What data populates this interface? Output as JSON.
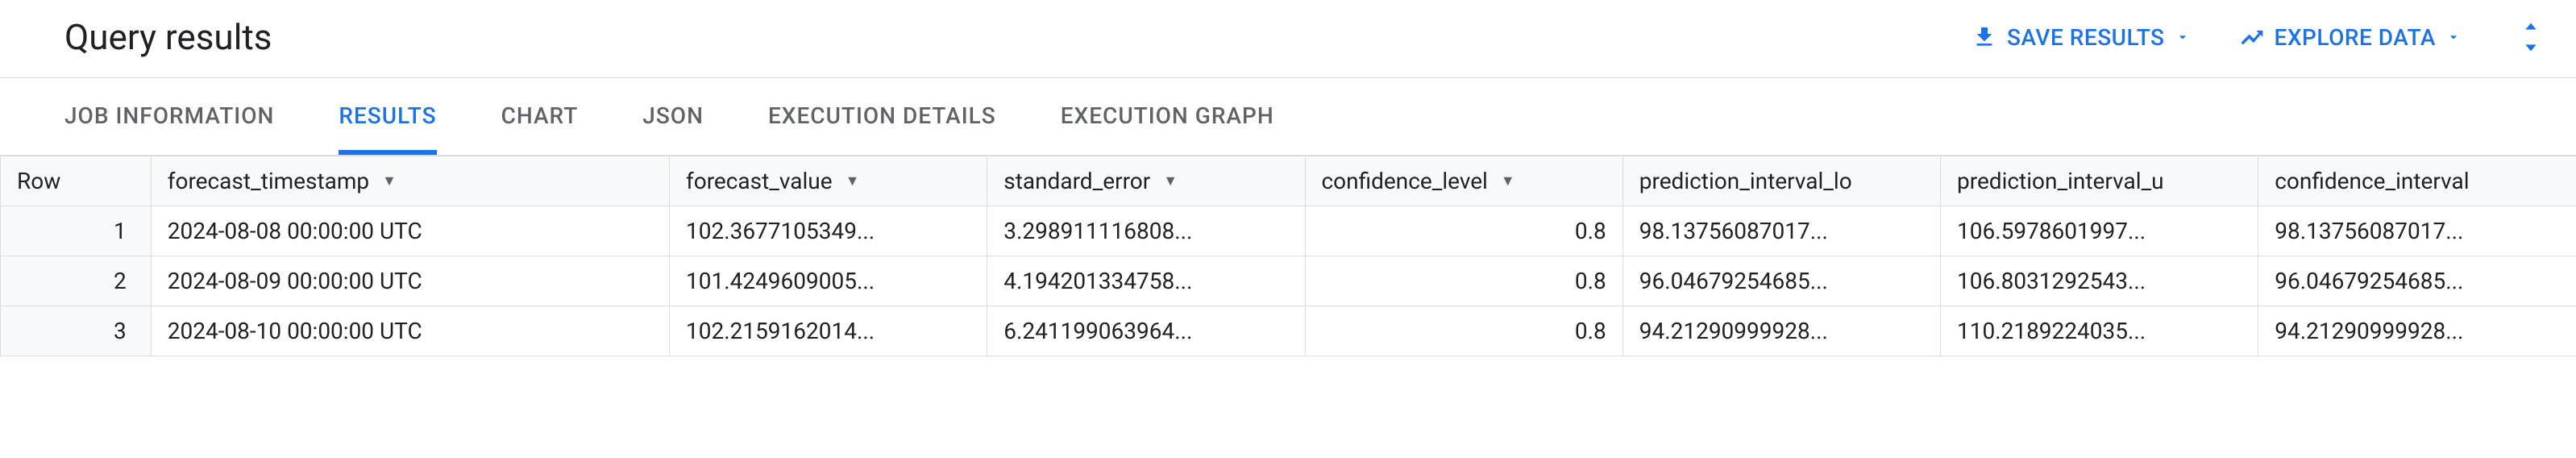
{
  "header": {
    "title": "Query results",
    "save_label": "SAVE RESULTS",
    "explore_label": "EXPLORE DATA"
  },
  "tabs": {
    "job_info": "JOB INFORMATION",
    "results": "RESULTS",
    "chart": "CHART",
    "json": "JSON",
    "execution_details": "EXECUTION DETAILS",
    "execution_graph": "EXECUTION GRAPH"
  },
  "columns": {
    "row": "Row",
    "forecast_timestamp": "forecast_timestamp",
    "forecast_value": "forecast_value",
    "standard_error": "standard_error",
    "confidence_level": "confidence_level",
    "prediction_interval_lower": "prediction_interval_lo",
    "prediction_interval_upper": "prediction_interval_u",
    "confidence_interval": "confidence_interval"
  },
  "rows": [
    {
      "row": "1",
      "forecast_timestamp": "2024-08-08 00:00:00 UTC",
      "forecast_value": "102.3677105349...",
      "standard_error": "3.298911116808...",
      "confidence_level": "0.8",
      "prediction_interval_lower": "98.13756087017...",
      "prediction_interval_upper": "106.5978601997...",
      "confidence_interval": "98.13756087017..."
    },
    {
      "row": "2",
      "forecast_timestamp": "2024-08-09 00:00:00 UTC",
      "forecast_value": "101.4249609005...",
      "standard_error": "4.194201334758...",
      "confidence_level": "0.8",
      "prediction_interval_lower": "96.04679254685...",
      "prediction_interval_upper": "106.8031292543...",
      "confidence_interval": "96.04679254685..."
    },
    {
      "row": "3",
      "forecast_timestamp": "2024-08-10 00:00:00 UTC",
      "forecast_value": "102.2159162014...",
      "standard_error": "6.241199063964...",
      "confidence_level": "0.8",
      "prediction_interval_lower": "94.21290999928...",
      "prediction_interval_upper": "110.2189224035...",
      "confidence_interval": "94.21290999928..."
    }
  ]
}
